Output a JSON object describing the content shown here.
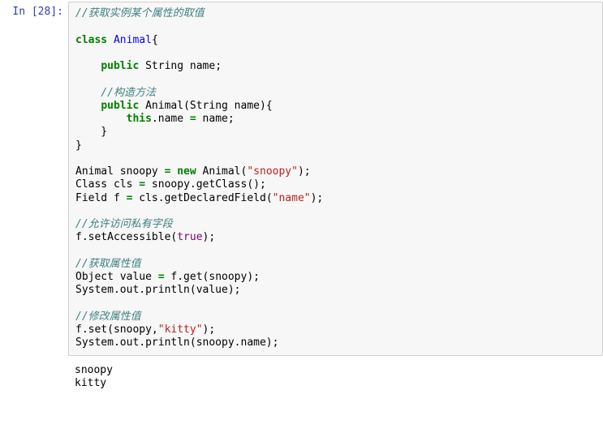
{
  "input": {
    "prompt": "In [28]:",
    "code_plain": "//获取实例某个属性的取值\n\nclass Animal{\n\n    public String name;\n\n    //构造方法\n    public Animal(String name){\n        this.name = name;\n    }\n}\n\nAnimal snoopy = new Animal(\"snoopy\");\nClass cls = snoopy.getClass();\nField f = cls.getDeclaredField(\"name\");\n\n//允许访问私有字段\nf.setAccessible(true);\n\n//获取属性值\nObject value = f.get(snoopy);\nSystem.out.println(value);\n\n//修改属性值\nf.set(snoopy,\"kitty\");\nSystem.out.println(snoopy.name);",
    "tokens": [
      [
        [
          "//获取实例某个属性的取值",
          "c"
        ]
      ],
      [],
      [
        [
          "class",
          "kw"
        ],
        [
          " ",
          ""
        ],
        [
          "Animal",
          "nc"
        ],
        [
          "{",
          ""
        ]
      ],
      [],
      [
        [
          "    ",
          ""
        ],
        [
          "public",
          "kw"
        ],
        [
          " String name;",
          ""
        ]
      ],
      [],
      [
        [
          "    ",
          ""
        ],
        [
          "//构造方法",
          "c"
        ]
      ],
      [
        [
          "    ",
          ""
        ],
        [
          "public",
          "kw"
        ],
        [
          " Animal(String name){",
          ""
        ]
      ],
      [
        [
          "        ",
          ""
        ],
        [
          "this",
          "kw"
        ],
        [
          ".name ",
          ""
        ],
        [
          "=",
          "kw"
        ],
        [
          " name;",
          ""
        ]
      ],
      [
        [
          "    }",
          ""
        ]
      ],
      [
        [
          "}",
          ""
        ]
      ],
      [],
      [
        [
          "Animal snoopy ",
          ""
        ],
        [
          "=",
          "kw"
        ],
        [
          " ",
          ""
        ],
        [
          "new",
          "kw"
        ],
        [
          " Animal(",
          ""
        ],
        [
          "\"snoopy\"",
          "s"
        ],
        [
          ");",
          ""
        ]
      ],
      [
        [
          "Class cls ",
          ""
        ],
        [
          "=",
          "kw"
        ],
        [
          " snoopy.getClass();",
          ""
        ]
      ],
      [
        [
          "Field f ",
          ""
        ],
        [
          "=",
          "kw"
        ],
        [
          " cls.getDeclaredField(",
          ""
        ],
        [
          "\"name\"",
          "s"
        ],
        [
          ");",
          ""
        ]
      ],
      [],
      [
        [
          "//允许访问私有字段",
          "c"
        ]
      ],
      [
        [
          "f.setAccessible(",
          ""
        ],
        [
          "true",
          "lt"
        ],
        [
          ");",
          ""
        ]
      ],
      [],
      [
        [
          "//获取属性值",
          "c"
        ]
      ],
      [
        [
          "Object value ",
          ""
        ],
        [
          "=",
          "kw"
        ],
        [
          " f.get(snoopy);",
          ""
        ]
      ],
      [
        [
          "System.out.println(value);",
          ""
        ]
      ],
      [],
      [
        [
          "//修改属性值",
          "c"
        ]
      ],
      [
        [
          "f.set(snoopy,",
          ""
        ],
        [
          "\"kitty\"",
          "s"
        ],
        [
          ");",
          ""
        ]
      ],
      [
        [
          "System.out.println(snoopy.name);",
          ""
        ]
      ],
      []
    ]
  },
  "output": {
    "text": "snoopy\nkitty"
  }
}
